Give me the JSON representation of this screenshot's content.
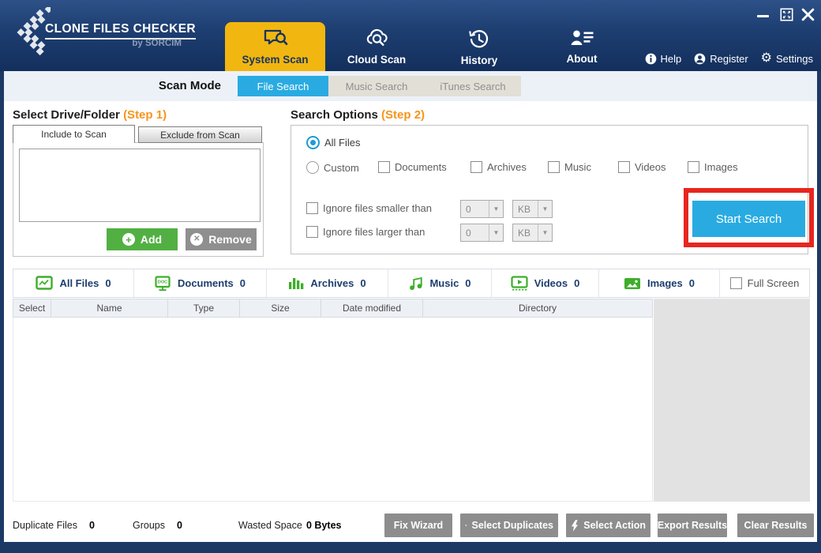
{
  "header": {
    "brand": {
      "title": "CLONE FILES CHECKER",
      "subtitle": "by SORCIM"
    },
    "nav": [
      {
        "label": "System Scan"
      },
      {
        "label": "Cloud Scan"
      },
      {
        "label": "History"
      },
      {
        "label": "About"
      }
    ],
    "links": [
      {
        "label": "Help"
      },
      {
        "label": "Register"
      },
      {
        "label": "Settings"
      }
    ]
  },
  "scan_mode": {
    "label": "Scan Mode",
    "tabs": [
      {
        "label": "File Search"
      },
      {
        "label": "Music Search"
      },
      {
        "label": "iTunes Search"
      }
    ]
  },
  "drive_panel": {
    "title": "Select Drive/Folder",
    "step": "(Step 1)",
    "tabs": [
      {
        "label": "Include to Scan"
      },
      {
        "label": "Exclude from Scan"
      }
    ],
    "add_label": "Add",
    "remove_label": "Remove"
  },
  "search_options": {
    "title": "Search Options",
    "step": "(Step 2)",
    "all_files_label": "All Files",
    "custom_label": "Custom",
    "type_checkboxes": [
      "Documents",
      "Archives",
      "Music",
      "Videos",
      "Images"
    ],
    "ignore_smaller_label": "Ignore files smaller than",
    "ignore_larger_label": "Ignore files larger than",
    "size_value": "0",
    "size_unit": "KB",
    "start_button": "Start Search"
  },
  "results_tabs": {
    "items": [
      {
        "label": "All Files",
        "count": "0"
      },
      {
        "label": "Documents",
        "count": "0"
      },
      {
        "label": "Archives",
        "count": "0"
      },
      {
        "label": "Music",
        "count": "0"
      },
      {
        "label": "Videos",
        "count": "0"
      },
      {
        "label": "Images",
        "count": "0"
      }
    ],
    "full_screen_label": "Full Screen"
  },
  "results_table": {
    "columns": [
      "Select",
      "Name",
      "Type",
      "Size",
      "Date modified",
      "Directory"
    ],
    "rows": []
  },
  "status_bar": {
    "stats": [
      {
        "label": "Duplicate Files",
        "value": "0"
      },
      {
        "label": "Groups",
        "value": "0"
      },
      {
        "label": "Wasted Space",
        "value": "0 Bytes"
      }
    ],
    "buttons": [
      "Fix Wizard",
      "Select Duplicates",
      "Select Action",
      "Export Results",
      "Clear Results"
    ]
  },
  "colors": {
    "navy": "#1c3966",
    "accent_yellow": "#f2b610",
    "accent_blue": "#29abe2",
    "accent_green": "#3dae2b",
    "step_orange": "#f7941d",
    "highlight_red": "#e7261e",
    "button_gray": "#8d8d8d"
  }
}
